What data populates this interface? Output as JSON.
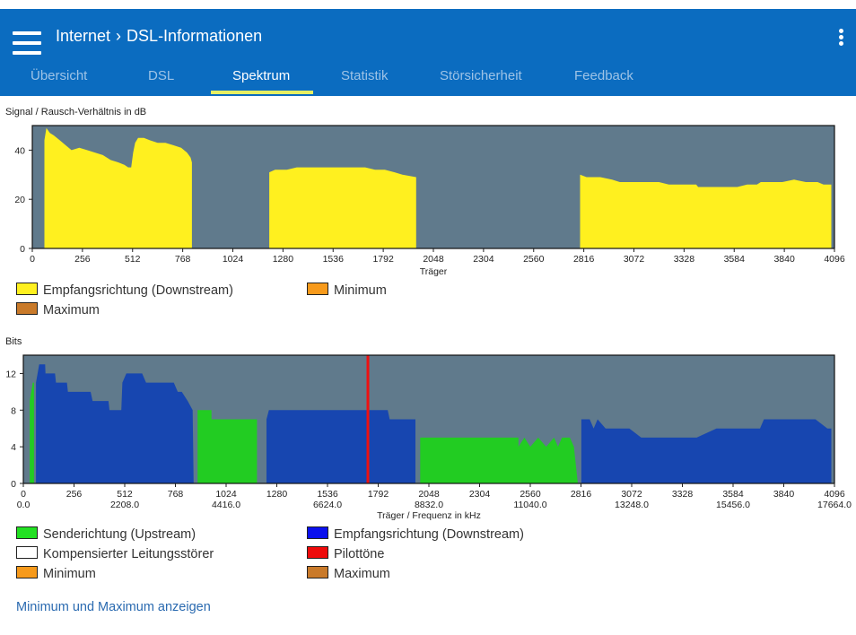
{
  "header": {
    "breadcrumb_root": "Internet",
    "breadcrumb_sep": "›",
    "breadcrumb_page": "DSL-Informationen",
    "tabs": [
      "Übersicht",
      "DSL",
      "Spektrum",
      "Statistik",
      "Störsicherheit",
      "Feedback"
    ],
    "active_tab": "Spektrum",
    "colors": {
      "bar": "#0b6cc0",
      "active_tab_underline": "#e6ef63"
    }
  },
  "snr_chart": {
    "title": "Signal / Rausch-Verhältnis in dB",
    "xlabel": "Träger",
    "legend": [
      {
        "label": "Empfangsrichtung (Downstream)",
        "color": "#fff01f"
      },
      {
        "label": "Minimum",
        "color": "#f79a1b"
      },
      {
        "label": "Maximum",
        "color": "#c97a2a"
      }
    ]
  },
  "bits_chart": {
    "title": "Bits",
    "xlabel": "Träger / Frequenz in kHz",
    "legend": [
      {
        "label": "Senderichtung (Upstream)",
        "color": "#22e022"
      },
      {
        "label": "Empfangsrichtung (Downstream)",
        "color": "#0b10ee"
      },
      {
        "label": "Kompensierter Leitungsstörer",
        "color": "#ffffff"
      },
      {
        "label": "Pilottöne",
        "color": "#ee0b0b"
      },
      {
        "label": "Minimum",
        "color": "#f79a1b"
      },
      {
        "label": "Maximum",
        "color": "#c97a2a"
      }
    ]
  },
  "show_minmax_link": "Minimum und Maximum anzeigen",
  "chart_data": [
    {
      "type": "area",
      "title": "Signal / Rausch-Verhältnis in dB",
      "xlabel": "Träger",
      "ylabel": "",
      "xlim": [
        0,
        4096
      ],
      "ylim": [
        0,
        50
      ],
      "xticks": [
        0,
        256,
        512,
        768,
        1024,
        1280,
        1536,
        1792,
        2048,
        2304,
        2560,
        2816,
        3072,
        3328,
        3584,
        3840,
        4096
      ],
      "yticks": [
        0,
        20,
        40
      ],
      "plot_bg": "#607a8c",
      "series": [
        {
          "name": "Empfangsrichtung (Downstream)",
          "color": "#fff01f",
          "points": [
            [
              62,
              0
            ],
            [
              62,
              44
            ],
            [
              72,
              49
            ],
            [
              90,
              47
            ],
            [
              110,
              46
            ],
            [
              140,
              44
            ],
            [
              170,
              42
            ],
            [
              200,
              40
            ],
            [
              240,
              41
            ],
            [
              280,
              40
            ],
            [
              320,
              39
            ],
            [
              360,
              38
            ],
            [
              400,
              36
            ],
            [
              440,
              35
            ],
            [
              470,
              34
            ],
            [
              490,
              33
            ],
            [
              505,
              33
            ],
            [
              510,
              36
            ],
            [
              515,
              39
            ],
            [
              525,
              43
            ],
            [
              540,
              45
            ],
            [
              570,
              45
            ],
            [
              600,
              44
            ],
            [
              640,
              43
            ],
            [
              680,
              43
            ],
            [
              720,
              42
            ],
            [
              760,
              41
            ],
            [
              790,
              39
            ],
            [
              808,
              37
            ],
            [
              815,
              35
            ],
            [
              815,
              0
            ],
            [
              1210,
              0
            ],
            [
              1210,
              31
            ],
            [
              1240,
              32
            ],
            [
              1300,
              32
            ],
            [
              1350,
              33
            ],
            [
              1400,
              33
            ],
            [
              1500,
              33
            ],
            [
              1600,
              33
            ],
            [
              1700,
              33
            ],
            [
              1750,
              32
            ],
            [
              1800,
              32
            ],
            [
              1850,
              31
            ],
            [
              1890,
              30
            ],
            [
              1960,
              29
            ],
            [
              1960,
              0
            ],
            [
              2797,
              0
            ],
            [
              2797,
              30
            ],
            [
              2830,
              29
            ],
            [
              2900,
              29
            ],
            [
              2960,
              28
            ],
            [
              3000,
              27
            ],
            [
              3100,
              27
            ],
            [
              3200,
              27
            ],
            [
              3250,
              26
            ],
            [
              3300,
              26
            ],
            [
              3390,
              26
            ],
            [
              3400,
              25
            ],
            [
              3600,
              25
            ],
            [
              3650,
              26
            ],
            [
              3700,
              26
            ],
            [
              3720,
              27
            ],
            [
              3830,
              27
            ],
            [
              3890,
              28
            ],
            [
              3950,
              27
            ],
            [
              4010,
              27
            ],
            [
              4040,
              26
            ],
            [
              4080,
              26
            ],
            [
              4080,
              0
            ]
          ]
        }
      ]
    },
    {
      "type": "area",
      "title": "Bits",
      "xlabel": "Träger / Frequenz in kHz",
      "ylabel": "",
      "xlim": [
        0,
        4096
      ],
      "ylim": [
        0,
        14
      ],
      "xticks": [
        0,
        256,
        512,
        768,
        1024,
        1280,
        1536,
        1792,
        2048,
        2304,
        2560,
        2816,
        3072,
        3328,
        3584,
        3840,
        4096
      ],
      "freq_ticks": [
        "0.0",
        "",
        "2208.0",
        "",
        "4416.0",
        "",
        "6624.0",
        "",
        "8832.0",
        "",
        "11040.0",
        "",
        "13248.0",
        "",
        "15456.0",
        "",
        "17664.0"
      ],
      "yticks": [
        0,
        4,
        8,
        12
      ],
      "plot_bg": "#607a8c",
      "series": [
        {
          "name": "Senderichtung (Upstream)",
          "color": "#22cc22",
          "points": [
            [
              32,
              0
            ],
            [
              32,
              9
            ],
            [
              40,
              10
            ],
            [
              48,
              11
            ],
            [
              54,
              11
            ],
            [
              54,
              0
            ],
            [
              880,
              0
            ],
            [
              880,
              8
            ],
            [
              950,
              8
            ],
            [
              950,
              7
            ],
            [
              1060,
              7
            ],
            [
              1060,
              7
            ],
            [
              1180,
              7
            ],
            [
              1180,
              0
            ],
            [
              2004,
              0
            ],
            [
              2004,
              5
            ],
            [
              2100,
              5
            ],
            [
              2200,
              5
            ],
            [
              2350,
              5
            ],
            [
              2500,
              5
            ],
            [
              2500,
              4
            ],
            [
              2530,
              5
            ],
            [
              2560,
              4
            ],
            [
              2600,
              5
            ],
            [
              2640,
              4
            ],
            [
              2680,
              5
            ],
            [
              2700,
              4
            ],
            [
              2720,
              5
            ],
            [
              2760,
              5
            ],
            [
              2780,
              4
            ],
            [
              2800,
              0
            ]
          ]
        },
        {
          "name": "Empfangsrichtung (Downstream)",
          "color": "#1746b0",
          "points": [
            [
              64,
              0
            ],
            [
              64,
              11
            ],
            [
              72,
              12
            ],
            [
              80,
              13
            ],
            [
              110,
              13
            ],
            [
              112,
              12
            ],
            [
              160,
              12
            ],
            [
              165,
              11
            ],
            [
              220,
              11
            ],
            [
              225,
              10
            ],
            [
              340,
              10
            ],
            [
              350,
              9
            ],
            [
              430,
              9
            ],
            [
              435,
              8
            ],
            [
              495,
              8
            ],
            [
              500,
              11
            ],
            [
              520,
              12
            ],
            [
              600,
              12
            ],
            [
              620,
              11
            ],
            [
              760,
              11
            ],
            [
              780,
              10
            ],
            [
              800,
              10
            ],
            [
              830,
              9
            ],
            [
              855,
              8
            ],
            [
              860,
              0
            ],
            [
              1228,
              0
            ],
            [
              1228,
              7
            ],
            [
              1240,
              8
            ],
            [
              1300,
              8
            ],
            [
              1520,
              8
            ],
            [
              1620,
              8
            ],
            [
              1760,
              8
            ],
            [
              1840,
              8
            ],
            [
              1850,
              7
            ],
            [
              1980,
              7
            ],
            [
              1980,
              0
            ],
            [
              2818,
              0
            ],
            [
              2818,
              7
            ],
            [
              2860,
              7
            ],
            [
              2880,
              6
            ],
            [
              2900,
              7
            ],
            [
              2940,
              6
            ],
            [
              3060,
              6
            ],
            [
              3120,
              5
            ],
            [
              3340,
              5
            ],
            [
              3400,
              5
            ],
            [
              3500,
              6
            ],
            [
              3720,
              6
            ],
            [
              3740,
              7
            ],
            [
              3800,
              7
            ],
            [
              4000,
              7
            ],
            [
              4060,
              6
            ],
            [
              4080,
              6
            ],
            [
              4080,
              0
            ]
          ]
        },
        {
          "name": "Pilottöne",
          "color": "#ee1111",
          "marker_x": 1740
        }
      ]
    }
  ]
}
